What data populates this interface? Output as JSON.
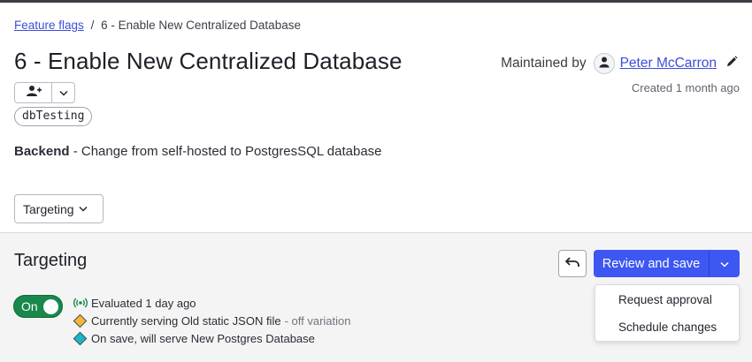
{
  "breadcrumb": {
    "parent": "Feature flags",
    "separator": "/",
    "current": "6 - Enable New Centralized Database"
  },
  "flag": {
    "title": "6 - Enable New Centralized Database",
    "tag": "dbTesting",
    "description_label": "Backend",
    "description_text": " - Change from self-hosted to PostgresSQL database"
  },
  "maintainer": {
    "prefix": "Maintained by",
    "name": "Peter McCarron",
    "created": "Created 1 month ago"
  },
  "view_select": {
    "label": "Targeting"
  },
  "targeting": {
    "title": "Targeting",
    "review_button": "Review and save",
    "menu": [
      "Request approval",
      "Schedule changes"
    ],
    "toggle_label": "On",
    "evaluated": "Evaluated 1 day ago",
    "serving": "Currently serving Old static JSON file",
    "serving_note": "- off variation",
    "on_save": "On save, will serve New Postgres Database"
  },
  "colors": {
    "accent": "#3d57f2",
    "on_toggle": "#18884b",
    "off_variation": "#f3b73a",
    "new_variation": "#1ab6c9",
    "link": "#3c4fd8"
  },
  "icons": [
    "user-plus-icon",
    "chevron-down-icon",
    "user-icon",
    "pencil-icon",
    "undo-icon",
    "broadcast-icon",
    "diamond-icon"
  ]
}
